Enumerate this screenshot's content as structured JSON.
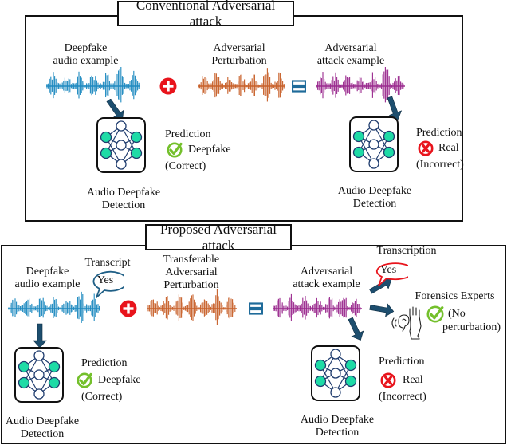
{
  "colors": {
    "deepfake_wave": "#1f8ac0",
    "perturbation_wave": "#c8602a",
    "adversarial_wave": "#9a2a8e",
    "arrow": "#1d4e6e",
    "plus_red": "#e8141c",
    "equals_blue": "#1f6b9a",
    "node_teal": "#1edba6",
    "node_edge": "#1f3c6e",
    "check_green": "#74c02c",
    "cross_red": "#e8141c",
    "bubble_blue": "#1f5f86",
    "bubble_red": "#e8141c"
  },
  "conventional": {
    "title": "Conventional Adversarial attack",
    "deepfake_label": [
      "Deepfake",
      "audio example"
    ],
    "perturbation_label": [
      "Adversarial",
      "Perturbation"
    ],
    "adversarial_label": [
      "Adversarial",
      "attack example"
    ],
    "left_detector": {
      "label": [
        "Audio Deepfake",
        "Detection"
      ],
      "prediction_title": "Prediction",
      "prediction_value": "Deepfake",
      "prediction_status": "(Correct)",
      "status_icon": "check-icon"
    },
    "right_detector": {
      "label": [
        "Audio Deepfake",
        "Detection"
      ],
      "prediction_title": "Prediction",
      "prediction_value": "Real",
      "prediction_status": "(Incorrect)",
      "status_icon": "cross-icon"
    }
  },
  "proposed": {
    "title": "Proposed Adversarial attack",
    "deepfake_label": [
      "Deepfake",
      "audio example"
    ],
    "transcript_label": "Transcript",
    "transcript_bubble": "Yes",
    "perturbation_label": [
      "Transferable",
      "Adversarial",
      "Perturbation"
    ],
    "adversarial_label": [
      "Adversarial",
      "attack example"
    ],
    "transcription_label": "Transcription",
    "transcription_bubble": "Yes",
    "forensics_label": "Forensics Experts",
    "forensics_result": [
      "(No",
      "perturbation)"
    ],
    "left_detector": {
      "label": [
        "Audio Deepfake",
        "Detection"
      ],
      "prediction_title": "Prediction",
      "prediction_value": "Deepfake",
      "prediction_status": "(Correct)",
      "status_icon": "check-icon"
    },
    "right_detector": {
      "label": [
        "Audio Deepfake",
        "Detection"
      ],
      "prediction_title": "Prediction",
      "prediction_value": "Real",
      "prediction_status": "(Incorrect)",
      "status_icon": "cross-icon"
    }
  }
}
